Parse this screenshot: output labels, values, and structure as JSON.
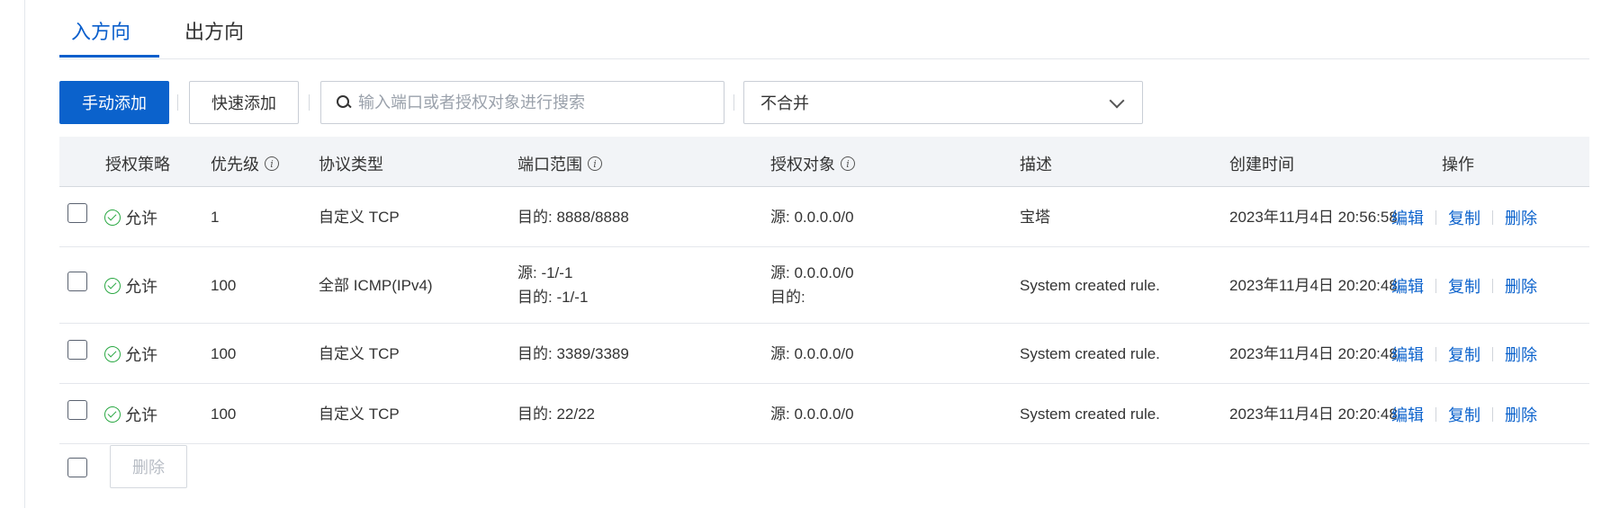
{
  "tabs": [
    {
      "label": "入方向",
      "active": true
    },
    {
      "label": "出方向",
      "active": false
    }
  ],
  "toolbar": {
    "manual_add_label": "手动添加",
    "quick_add_label": "快速添加",
    "search_placeholder": "输入端口或者授权对象进行搜索",
    "merge_select_value": "不合并"
  },
  "table": {
    "headers": {
      "policy": "授权策略",
      "priority": "优先级",
      "protocol": "协议类型",
      "port_range": "端口范围",
      "auth_object": "授权对象",
      "description": "描述",
      "created_at": "创建时间",
      "actions": "操作"
    },
    "rows": [
      {
        "policy": "允许",
        "priority": "1",
        "protocol": "自定义 TCP",
        "port_line1": "目的: 8888/8888",
        "port_line2": "",
        "auth_line1": "源: 0.0.0.0/0",
        "auth_line2": "",
        "description": "宝塔",
        "created_at": "2023年11月4日 20:56:58"
      },
      {
        "policy": "允许",
        "priority": "100",
        "protocol": "全部 ICMP(IPv4)",
        "port_line1": "源: -1/-1",
        "port_line2": "目的: -1/-1",
        "auth_line1": "源: 0.0.0.0/0",
        "auth_line2": "目的:",
        "description": "System created rule.",
        "created_at": "2023年11月4日 20:20:48"
      },
      {
        "policy": "允许",
        "priority": "100",
        "protocol": "自定义 TCP",
        "port_line1": "目的: 3389/3389",
        "port_line2": "",
        "auth_line1": "源: 0.0.0.0/0",
        "auth_line2": "",
        "description": "System created rule.",
        "created_at": "2023年11月4日 20:20:48"
      },
      {
        "policy": "允许",
        "priority": "100",
        "protocol": "自定义 TCP",
        "port_line1": "目的: 22/22",
        "port_line2": "",
        "auth_line1": "源: 0.0.0.0/0",
        "auth_line2": "",
        "description": "System created rule.",
        "created_at": "2023年11月4日 20:20:48"
      }
    ],
    "actions": {
      "edit": "编辑",
      "copy": "复制",
      "delete": "删除"
    }
  },
  "footer": {
    "delete_label": "删除"
  },
  "colors": {
    "accent": "#0b62cc",
    "allow_green": "#2aa843",
    "header_bg": "#f2f4f7"
  }
}
